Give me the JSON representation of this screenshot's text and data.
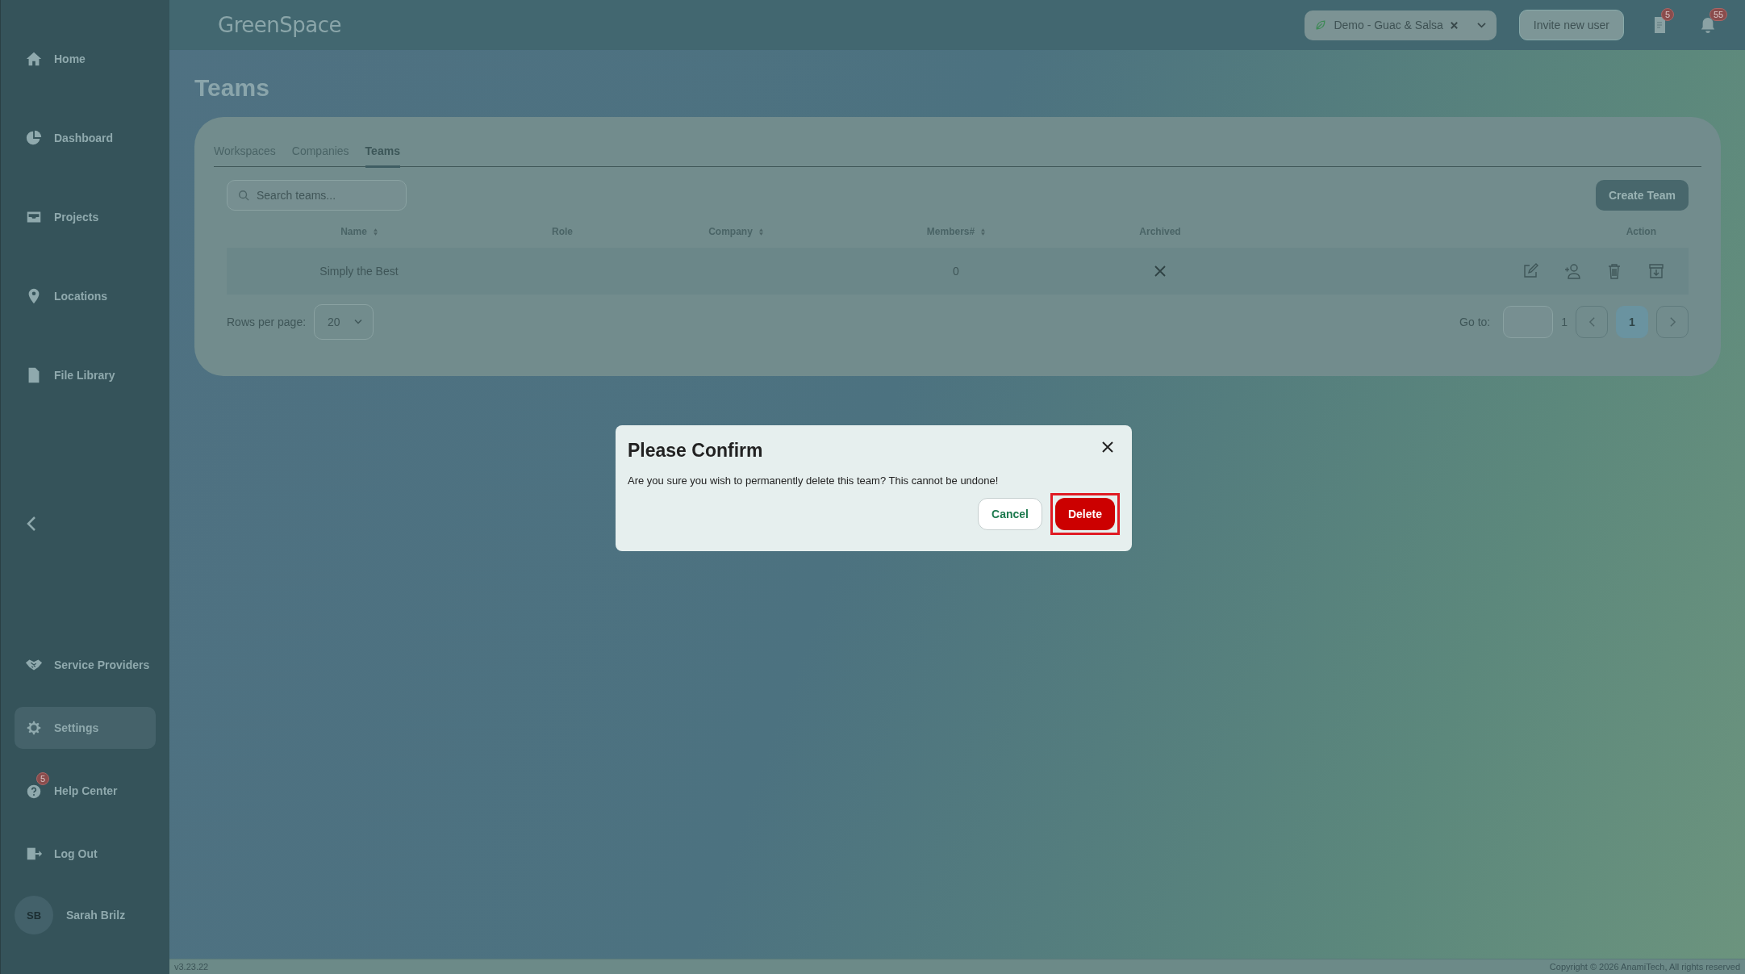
{
  "topbar": {
    "logo": "GreenSpace",
    "workspace": "Demo - Guac & Salsa",
    "invite_button": "Invite new user",
    "documents_badge": "5",
    "notifications_badge": "55"
  },
  "sidebar": {
    "items": [
      {
        "label": "Home",
        "selected": false
      },
      {
        "label": "Dashboard",
        "selected": false
      },
      {
        "label": "Projects",
        "selected": false
      },
      {
        "label": "Locations",
        "selected": false
      },
      {
        "label": "File Library",
        "selected": false
      },
      {
        "label": "Service Providers",
        "selected": false
      },
      {
        "label": "Settings",
        "selected": true
      },
      {
        "label": "Help Center",
        "selected": false,
        "badge": "5"
      },
      {
        "label": "Log Out",
        "selected": false
      }
    ],
    "user": {
      "initials": "SB",
      "name": "Sarah Brilz"
    }
  },
  "page": {
    "title": "Teams"
  },
  "tabs": [
    {
      "label": "Workspaces",
      "selected": false
    },
    {
      "label": "Companies",
      "selected": false
    },
    {
      "label": "Teams",
      "selected": true
    }
  ],
  "search": {
    "placeholder": "Search teams..."
  },
  "create_button": "Create Team",
  "table": {
    "columns": [
      "Name",
      "Role",
      "Company",
      "Members#",
      "Archived",
      "Action"
    ],
    "rows": [
      {
        "name": "Simply the Best",
        "members": "0",
        "archived": false
      }
    ]
  },
  "pagination": {
    "rows_per_page_label": "Rows per page:",
    "rows_per_page": "20",
    "goto_label": "Go to:",
    "total_pages": "1",
    "pages": [
      {
        "label": "1",
        "selected": true
      }
    ]
  },
  "dialog": {
    "title": "Please Confirm",
    "message": "Are you sure you wish to permanently delete this team? This cannot be undone!",
    "cancel": "Cancel",
    "confirm": "Delete",
    "confirm_highlighted": true
  },
  "footer": {
    "version": "v3.23.22",
    "copyright": "Copyright © 2026 AnamiTech, All rights reserved"
  }
}
